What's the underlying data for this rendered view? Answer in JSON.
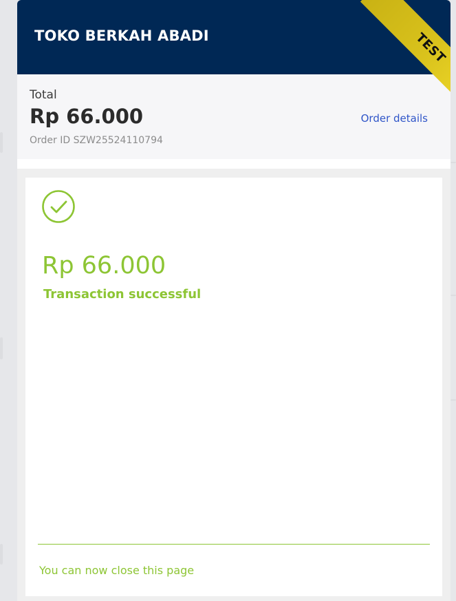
{
  "merchant": {
    "name": "TOKO BERKAH ABADI"
  },
  "ribbon": {
    "label": "TEST",
    "color": "#e2c920"
  },
  "summary": {
    "total_label": "Total",
    "total_amount": "Rp 66.000",
    "order_id": "Order ID SZW25524110794",
    "order_details_label": "Order details"
  },
  "status": {
    "icon": "check-circle-icon",
    "amount": "Rp 66.000",
    "message": "Transaction successful",
    "close_note": "You can now close this page"
  },
  "colors": {
    "header_bg": "#002855",
    "success": "#8dc534",
    "link": "#2f55c8"
  }
}
